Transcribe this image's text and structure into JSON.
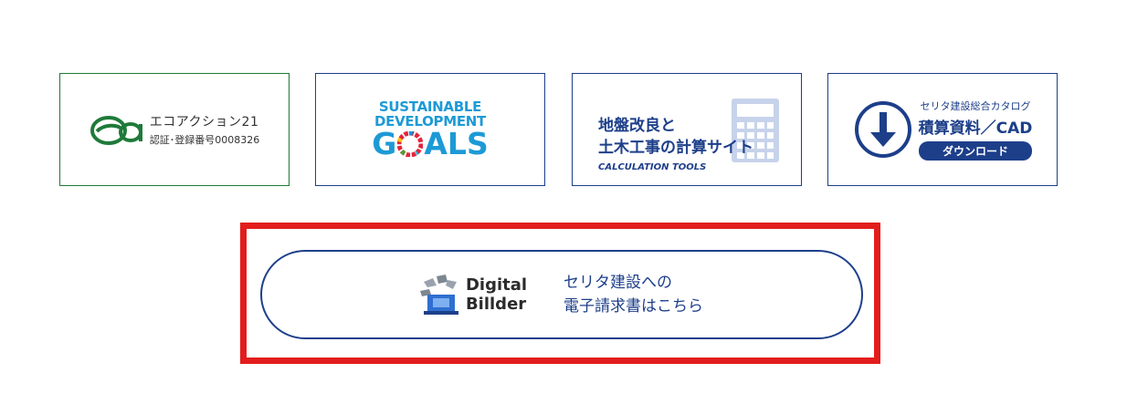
{
  "banners": {
    "eco_action": {
      "title": "エコアクション21",
      "sub": "認証･登録番号0008326"
    },
    "sdgs": {
      "line1": "SUSTAINABLE",
      "line2": "DEVELOPMENT",
      "goals_g": "G",
      "goals_rest": "ALS"
    },
    "calc": {
      "line1": "地盤改良と",
      "line2": "土木工事の計算サイト",
      "line3": "CALCULATION TOOLS"
    },
    "cad": {
      "small": "セリタ建設総合カタログ",
      "big": "積算資料／CAD",
      "pill": "ダウンロード"
    }
  },
  "invoice": {
    "logo_line1": "Digital",
    "logo_line2": "Billder",
    "text_line1": "セリタ建設への",
    "text_line2": "電子請求書はこちら"
  },
  "colors": {
    "navy": "#1d3f8a",
    "eco_green": "#1f7a3a",
    "sdg_blue": "#1d9ad6",
    "highlight_red": "#e31d1d"
  }
}
